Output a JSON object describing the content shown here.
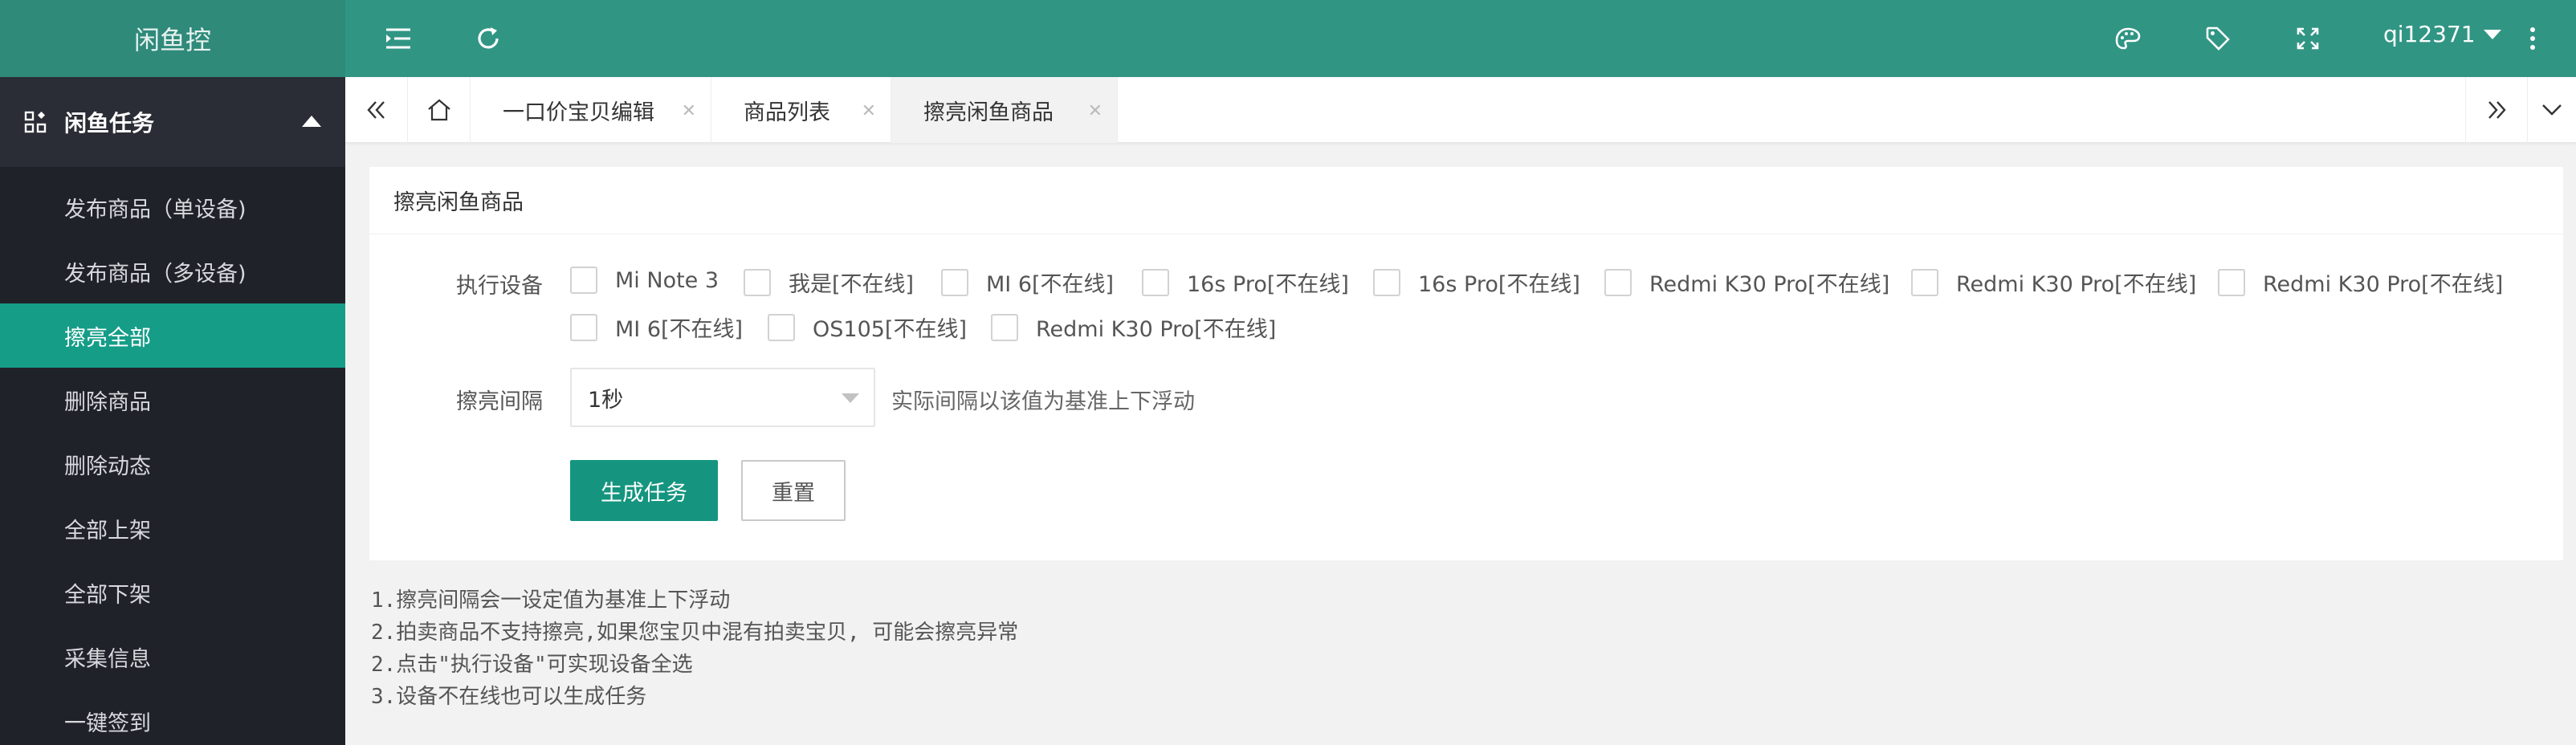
{
  "sidebar": {
    "logo": "闲鱼控",
    "group_label": "闲鱼任务",
    "items": [
      {
        "label": "发布商品（单设备)",
        "active": false
      },
      {
        "label": "发布商品（多设备)",
        "active": false
      },
      {
        "label": "擦亮全部",
        "active": true
      },
      {
        "label": "删除商品",
        "active": false
      },
      {
        "label": "删除动态",
        "active": false
      },
      {
        "label": "全部上架",
        "active": false
      },
      {
        "label": "全部下架",
        "active": false
      },
      {
        "label": "采集信息",
        "active": false
      },
      {
        "label": "一键签到",
        "active": false
      }
    ]
  },
  "header": {
    "user": "qi12371",
    "icons": [
      "menu-fold-icon",
      "refresh-icon",
      "palette-icon",
      "tag-icon",
      "fullscreen-icon",
      "more-vertical-icon"
    ]
  },
  "tabs": [
    {
      "label": "一口价宝贝编辑",
      "active": false
    },
    {
      "label": "商品列表",
      "active": false
    },
    {
      "label": "擦亮闲鱼商品",
      "active": true
    }
  ],
  "form": {
    "title": "擦亮闲鱼商品",
    "device_label": "执行设备",
    "devices_row1": [
      "Mi Note 3",
      "我是[不在线]",
      "MI 6[不在线]",
      "16s Pro[不在线]",
      "16s Pro[不在线]",
      "Redmi K30 Pro[不在线]",
      "Redmi K30 Pro[不在线]",
      "Redmi K30 Pro[不在线]"
    ],
    "devices_row2": [
      "MI 6[不在线]",
      "OS105[不在线]",
      "Redmi K30 Pro[不在线]"
    ],
    "interval_label": "擦亮间隔",
    "interval_value": "1秒",
    "interval_hint": "实际间隔以该值为基准上下浮动",
    "submit_label": "生成任务",
    "reset_label": "重置"
  },
  "notes": [
    "1.擦亮间隔会一设定值为基准上下浮动",
    "2.拍卖商品不支持擦亮,如果您宝贝中混有拍卖宝贝, 可能会擦亮异常",
    "2.点击\"执行设备\"可实现设备全选",
    "3.设备不在线也可以生成任务"
  ],
  "colors": {
    "header": "#319584",
    "sidebar": "#20222a",
    "accent": "#15957f"
  }
}
